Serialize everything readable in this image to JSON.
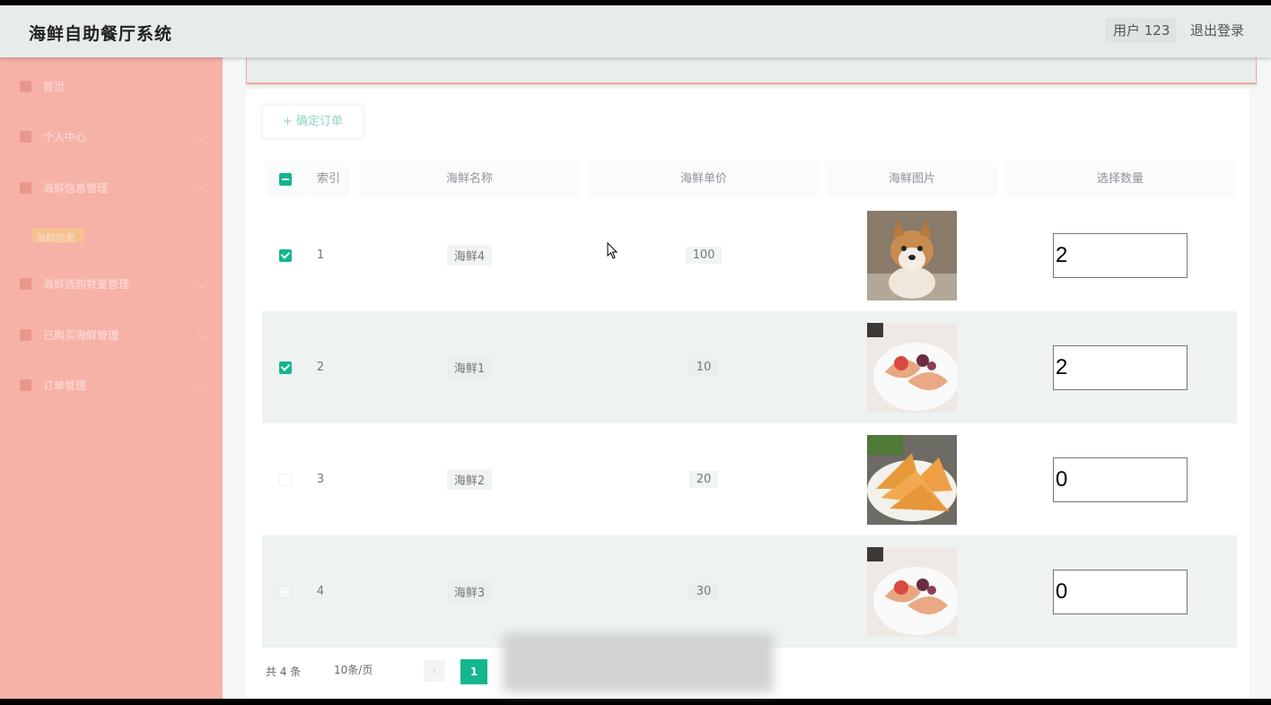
{
  "app": {
    "title": "海鲜自助餐厅系统"
  },
  "header": {
    "user_label": "用户 123",
    "logout_label": "退出登录"
  },
  "sidebar": {
    "items": [
      {
        "label": "首页",
        "icon": "home-icon"
      },
      {
        "label": "个人中心",
        "icon": "user-icon"
      },
      {
        "label": "海鲜信息管理",
        "icon": "menu-icon"
      },
      {
        "label": "海鲜信息",
        "icon": "",
        "sub": true
      },
      {
        "label": "海鲜选购数量管理",
        "icon": "cart-icon"
      },
      {
        "label": "已购买海鲜管理",
        "icon": "list-icon"
      },
      {
        "label": "订单管理",
        "icon": "order-icon"
      }
    ]
  },
  "toolbar": {
    "confirm_label": "+ 确定订单"
  },
  "table": {
    "headers": [
      "索引",
      "海鲜名称",
      "海鲜单价",
      "海鲜图片",
      "选择数量"
    ],
    "rows": [
      {
        "index": "1",
        "name": "海鲜4",
        "price": "100",
        "checked": true,
        "qty": "2",
        "image": "dog-photo"
      },
      {
        "index": "2",
        "name": "海鲜1",
        "price": "10",
        "checked": true,
        "qty": "2",
        "image": "seafood-plate-photo"
      },
      {
        "index": "3",
        "name": "海鲜2",
        "price": "20",
        "checked": false,
        "qty": "0",
        "image": "fried-seafood-photo"
      },
      {
        "index": "4",
        "name": "海鲜3",
        "price": "30",
        "checked": false,
        "qty": "0",
        "image": "seafood-plate-photo"
      }
    ]
  },
  "pager": {
    "total": "共 4 条",
    "page_size": "10条/页",
    "current_page": "1"
  },
  "colors": {
    "accent": "#13b68d",
    "sidebar": "#f7b2a8",
    "topbar": "#e5ecea"
  }
}
